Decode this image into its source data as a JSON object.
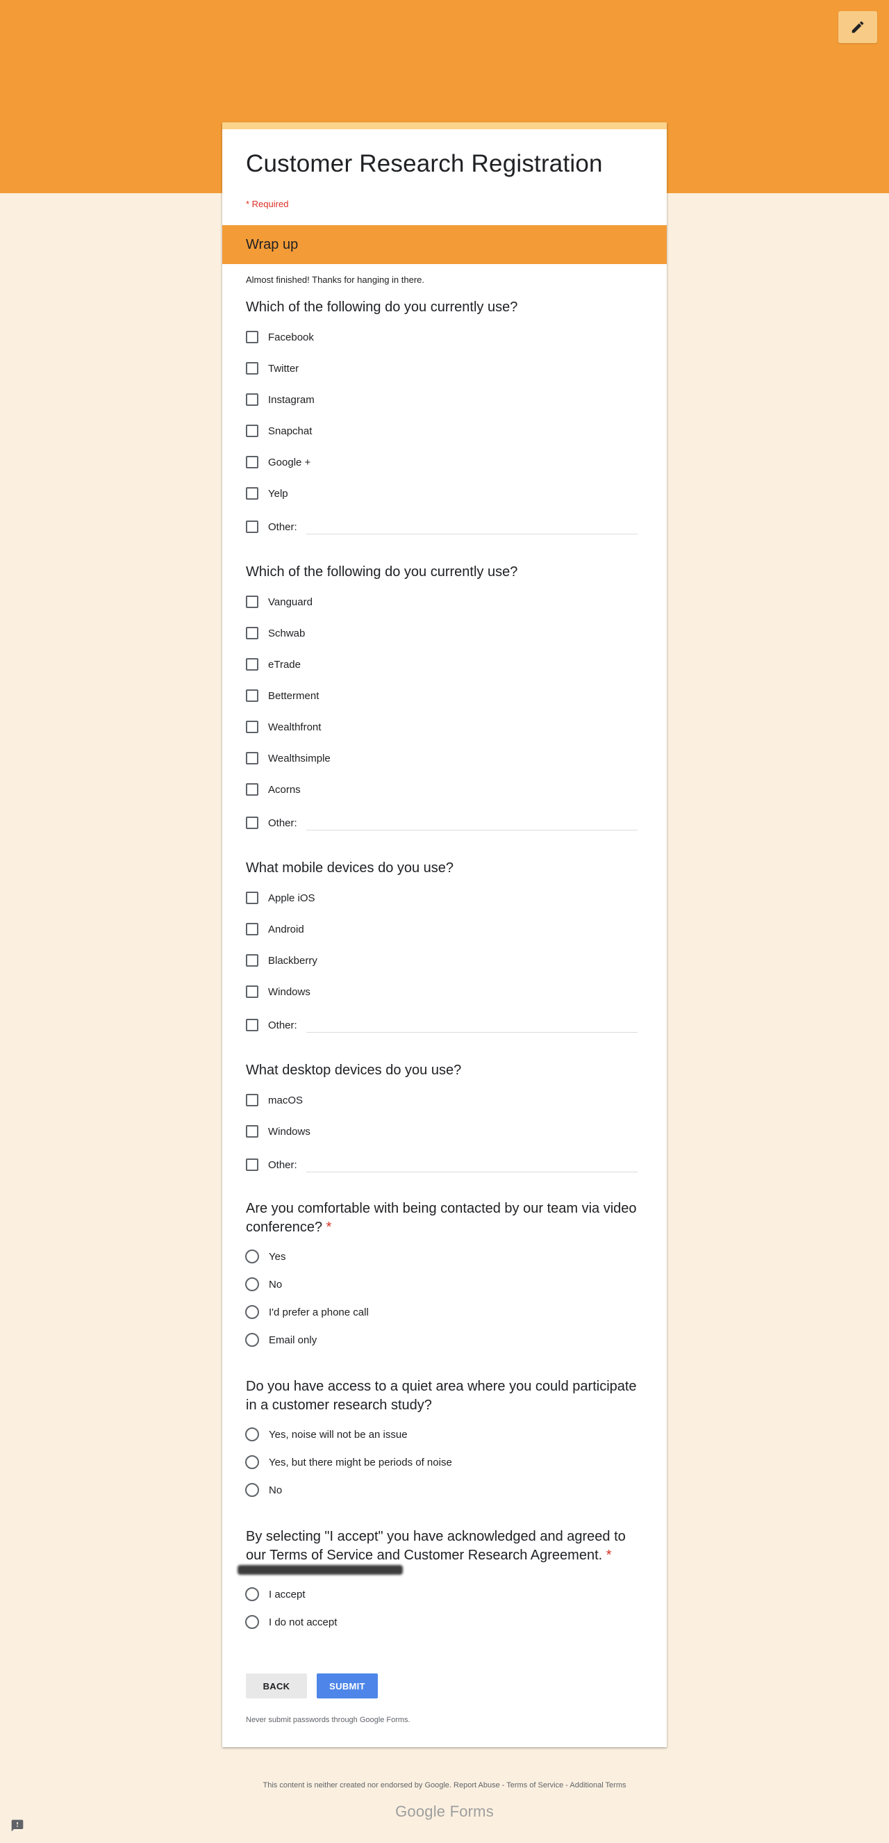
{
  "header": {
    "edit_icon": "pencil-icon",
    "colors": {
      "banner": "#f39c37",
      "background": "#fbf0e0",
      "accent_light": "#fbd38a"
    }
  },
  "form": {
    "title": "Customer Research Registration",
    "required_note": "* Required",
    "section_title": "Wrap up",
    "section_description": "Almost finished! Thanks for hanging in there."
  },
  "questions": {
    "social": {
      "title": "Which of the following do you currently use?",
      "options": [
        "Facebook",
        "Twitter",
        "Instagram",
        "Snapchat",
        "Google +",
        "Yelp"
      ],
      "other_label": "Other:"
    },
    "finance": {
      "title": "Which of the following do you currently use?",
      "options": [
        "Vanguard",
        "Schwab",
        "eTrade",
        "Betterment",
        "Wealthfront",
        "Wealthsimple",
        "Acorns"
      ],
      "other_label": "Other:"
    },
    "mobile": {
      "title": "What mobile devices do you use?",
      "options": [
        "Apple iOS",
        "Android",
        "Blackberry",
        "Windows"
      ],
      "other_label": "Other:"
    },
    "desktop": {
      "title": "What desktop devices do you use?",
      "options": [
        "macOS",
        "Windows"
      ],
      "other_label": "Other:"
    },
    "video": {
      "title_line1": "Are you comfortable with being contacted by our team via video",
      "title_line2": "conference?",
      "required_mark": "*",
      "options": [
        "Yes",
        "No",
        "I'd prefer a phone call",
        "Email only"
      ]
    },
    "quiet": {
      "title_line1": "Do you have access to a quiet area where you could participate",
      "title_line2": "in a customer research study?",
      "options": [
        "Yes, noise will not be an issue",
        "Yes, but there might be periods of noise",
        "No"
      ]
    },
    "terms": {
      "title_line1": "By selecting \"I accept\" you have acknowledged and agreed to",
      "title_line2": "our Terms of Service and Customer Research Agreement.",
      "required_mark": "*",
      "options": [
        "I accept",
        "I do not accept"
      ]
    }
  },
  "actions": {
    "back_label": "BACK",
    "submit_label": "SUBMIT",
    "password_note": "Never submit passwords through Google Forms."
  },
  "footer": {
    "disclaimer": "This content is neither created nor endorsed by Google.",
    "report_abuse": "Report Abuse",
    "terms": "Terms of Service",
    "additional_terms": "Additional Terms",
    "separator": " - ",
    "logo_google": "Google",
    "logo_forms": "Forms",
    "feedback_icon": "feedback-icon"
  }
}
